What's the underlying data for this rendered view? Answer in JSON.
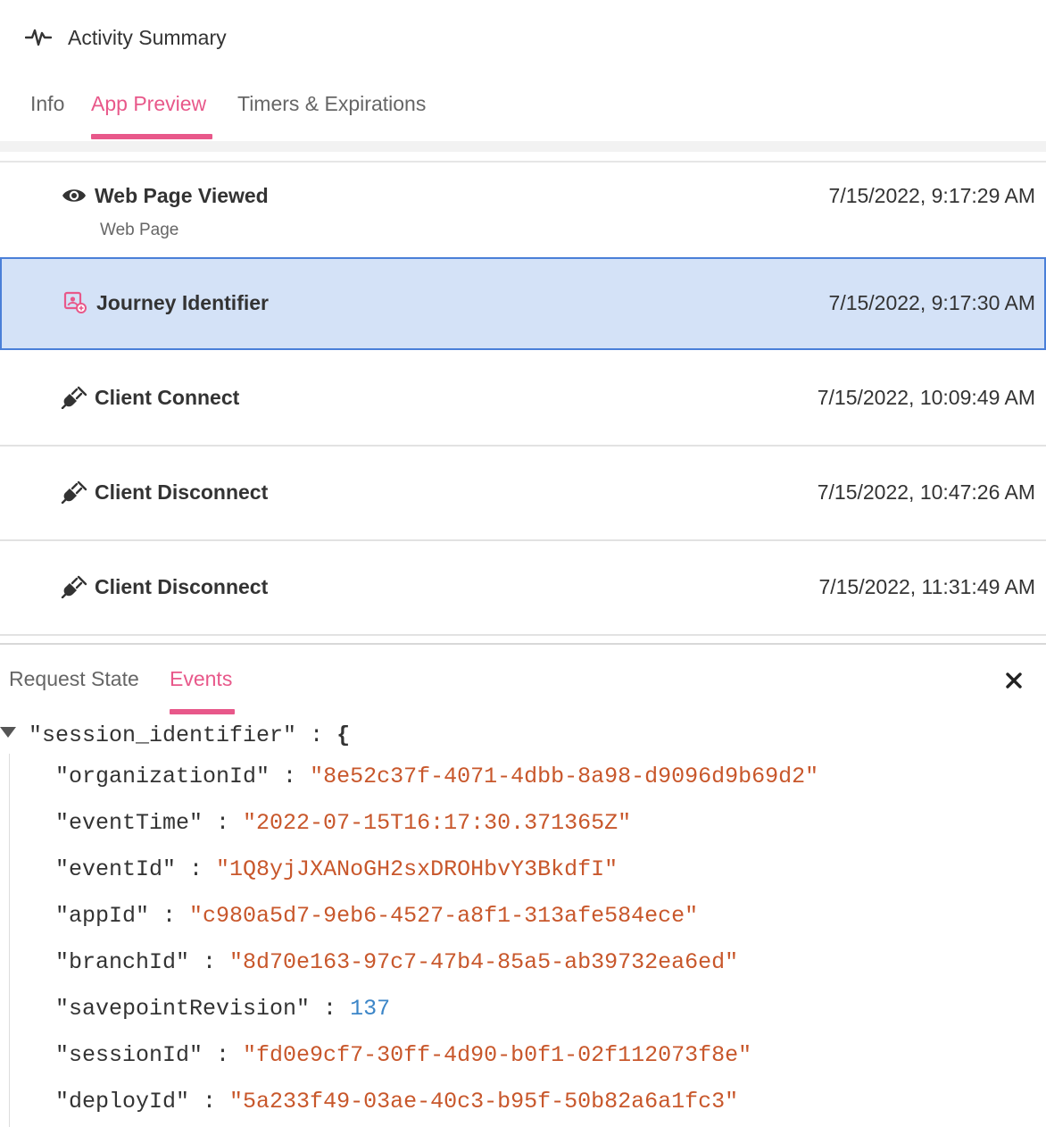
{
  "header": {
    "title": "Activity Summary",
    "icon": "pulse-icon"
  },
  "top_tabs": [
    {
      "label": "Info",
      "active": false
    },
    {
      "label": "App Preview",
      "active": true
    },
    {
      "label": "Timers & Expirations",
      "active": false
    }
  ],
  "activities": [
    {
      "icon": "eye-icon",
      "label": "Web Page Viewed",
      "sublabel": "Web Page",
      "time": "7/15/2022, 9:17:29 AM",
      "selected": false
    },
    {
      "icon": "journey-identifier-icon",
      "label": "Journey Identifier",
      "time": "7/15/2022, 9:17:30 AM",
      "selected": true
    },
    {
      "icon": "plug-icon",
      "label": "Client Connect",
      "time": "7/15/2022, 10:09:49 AM",
      "selected": false
    },
    {
      "icon": "plug-icon",
      "label": "Client Disconnect",
      "time": "7/15/2022, 10:47:26 AM",
      "selected": false
    },
    {
      "icon": "plug-icon",
      "label": "Client Disconnect",
      "time": "7/15/2022, 11:31:49 AM",
      "selected": false
    }
  ],
  "bottom_tabs": [
    {
      "label": "Request State",
      "active": false
    },
    {
      "label": "Events",
      "active": true
    }
  ],
  "json": {
    "root_key": "\"session_identifier\"",
    "separator": " : ",
    "open_brace": "{",
    "fields": [
      {
        "key": "\"organizationId\"",
        "value": "\"8e52c37f-4071-4dbb-8a98-d9096d9b69d2\"",
        "type": "string"
      },
      {
        "key": "\"eventTime\"",
        "value": "\"2022-07-15T16:17:30.371365Z\"",
        "type": "string"
      },
      {
        "key": "\"eventId\"",
        "value": "\"1Q8yjJXANoGH2sxDROHbvY3BkdfI\"",
        "type": "string"
      },
      {
        "key": "\"appId\"",
        "value": "\"c980a5d7-9eb6-4527-a8f1-313afe584ece\"",
        "type": "string"
      },
      {
        "key": "\"branchId\"",
        "value": "\"8d70e163-97c7-47b4-85a5-ab39732ea6ed\"",
        "type": "string"
      },
      {
        "key": "\"savepointRevision\"",
        "value": "137",
        "type": "number"
      },
      {
        "key": "\"sessionId\"",
        "value": "\"fd0e9cf7-30ff-4d90-b0f1-02f112073f8e\"",
        "type": "string"
      },
      {
        "key": "\"deployId\"",
        "value": "\"5a233f49-03ae-40c3-b95f-50b82a6a1fc3\"",
        "type": "string"
      }
    ]
  },
  "colors": {
    "accent": "#e8588a",
    "selected_bg": "#d4e2f7",
    "selected_border": "#4a7fd8",
    "json_string": "#c8572b",
    "json_number": "#3c86c8"
  }
}
